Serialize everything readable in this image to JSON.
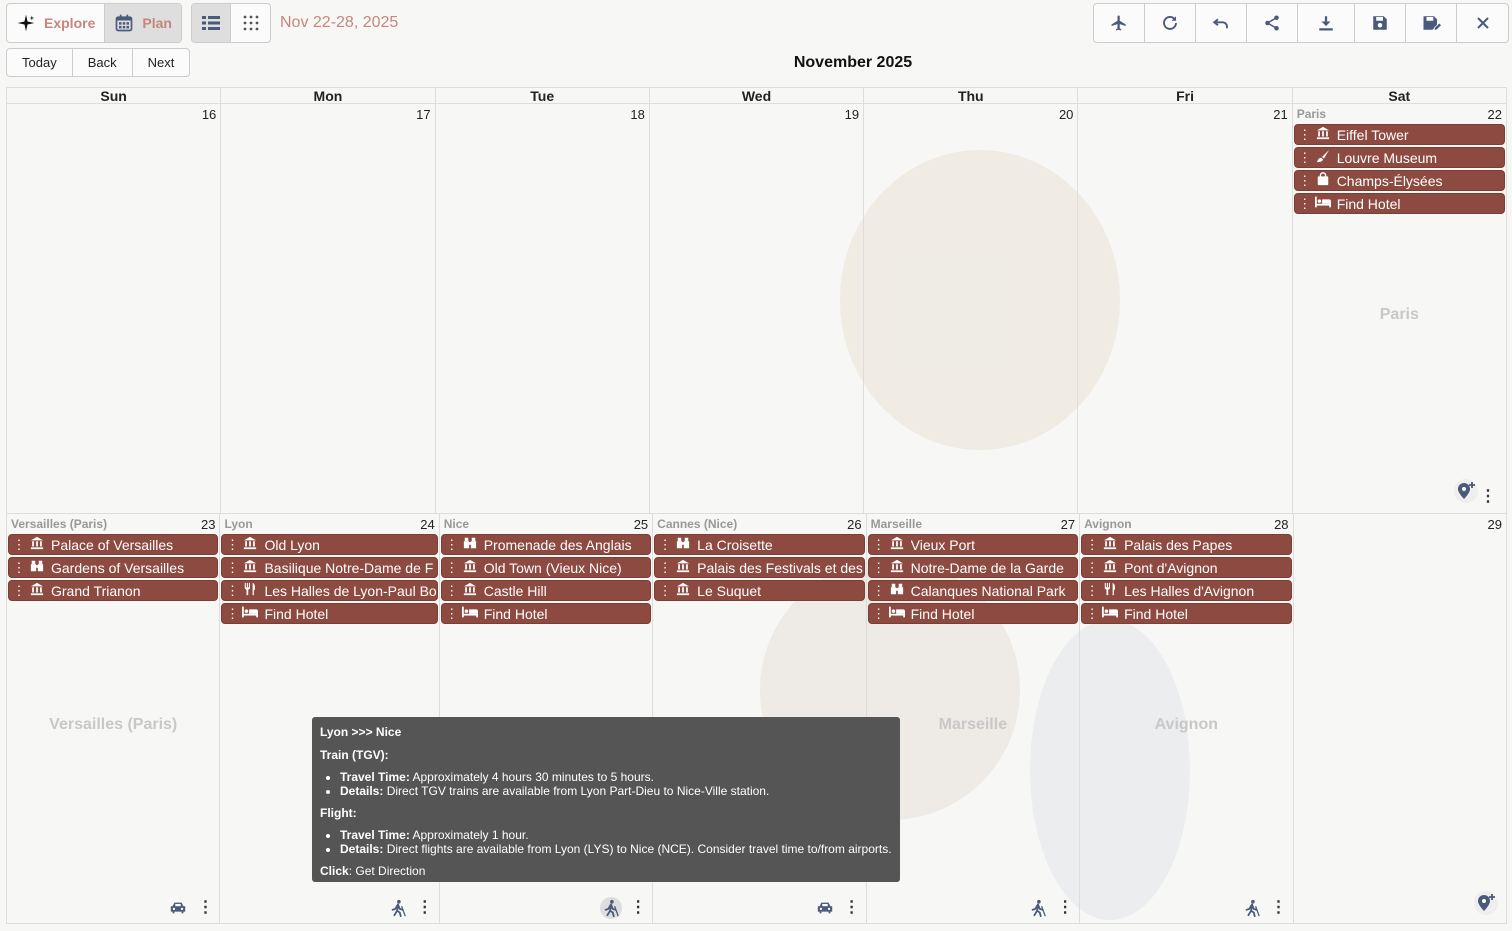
{
  "toolbar": {
    "explore_label": "Explore",
    "plan_label": "Plan",
    "date_range": "Nov 22-28, 2025",
    "today_label": "Today",
    "back_label": "Back",
    "next_label": "Next"
  },
  "calendar": {
    "month_title": "November 2025",
    "weekdays": [
      "Sun",
      "Mon",
      "Tue",
      "Wed",
      "Thu",
      "Fri",
      "Sat"
    ],
    "weeks": [
      {
        "days": [
          {
            "num": "16",
            "city": "",
            "watermark": "",
            "events": []
          },
          {
            "num": "17",
            "city": "",
            "watermark": "",
            "events": []
          },
          {
            "num": "18",
            "city": "",
            "watermark": "",
            "events": []
          },
          {
            "num": "19",
            "city": "",
            "watermark": "",
            "events": []
          },
          {
            "num": "20",
            "city": "",
            "watermark": "",
            "events": []
          },
          {
            "num": "21",
            "city": "",
            "watermark": "",
            "events": []
          },
          {
            "num": "22",
            "city": "Paris",
            "watermark": "Paris",
            "events": [
              {
                "icon": "museum-icon",
                "label": "Eiffel Tower"
              },
              {
                "icon": "brush-icon",
                "label": "Louvre Museum"
              },
              {
                "icon": "shopping-bag-icon",
                "label": "Champs-Élysées"
              },
              {
                "icon": "hotel-bed-icon",
                "label": "Find Hotel"
              }
            ]
          }
        ]
      },
      {
        "days": [
          {
            "num": "23",
            "city": "Versailles (Paris)",
            "watermark": "Versailles (Paris)",
            "events": [
              {
                "icon": "museum-icon",
                "label": "Palace of Versailles"
              },
              {
                "icon": "binoculars-icon",
                "label": "Gardens of Versailles"
              },
              {
                "icon": "museum-icon",
                "label": "Grand Trianon"
              }
            ]
          },
          {
            "num": "24",
            "city": "Lyon",
            "watermark": "",
            "events": [
              {
                "icon": "museum-icon",
                "label": "Old Lyon"
              },
              {
                "icon": "museum-icon",
                "label": "Basilique Notre-Dame de F"
              },
              {
                "icon": "fork-knife-icon",
                "label": "Les Halles de Lyon-Paul Bo"
              },
              {
                "icon": "hotel-bed-icon",
                "label": "Find Hotel"
              }
            ]
          },
          {
            "num": "25",
            "city": "Nice",
            "watermark": "",
            "events": [
              {
                "icon": "binoculars-icon",
                "label": "Promenade des Anglais"
              },
              {
                "icon": "museum-icon",
                "label": "Old Town (Vieux Nice)"
              },
              {
                "icon": "museum-icon",
                "label": "Castle Hill"
              },
              {
                "icon": "hotel-bed-icon",
                "label": "Find Hotel"
              }
            ]
          },
          {
            "num": "26",
            "city": "Cannes (Nice)",
            "watermark": "",
            "events": [
              {
                "icon": "binoculars-icon",
                "label": "La Croisette"
              },
              {
                "icon": "museum-icon",
                "label": "Palais des Festivals et des"
              },
              {
                "icon": "museum-icon",
                "label": "Le Suquet"
              }
            ]
          },
          {
            "num": "27",
            "city": "Marseille",
            "watermark": "Marseille",
            "events": [
              {
                "icon": "museum-icon",
                "label": "Vieux Port"
              },
              {
                "icon": "museum-icon",
                "label": "Notre-Dame de la Garde"
              },
              {
                "icon": "binoculars-icon",
                "label": "Calanques National Park"
              },
              {
                "icon": "hotel-bed-icon",
                "label": "Find Hotel"
              }
            ]
          },
          {
            "num": "28",
            "city": "Avignon",
            "watermark": "Avignon",
            "events": [
              {
                "icon": "museum-icon",
                "label": "Palais des Papes"
              },
              {
                "icon": "museum-icon",
                "label": "Pont d'Avignon"
              },
              {
                "icon": "fork-knife-icon",
                "label": "Les Halles d'Avignon"
              },
              {
                "icon": "hotel-bed-icon",
                "label": "Find Hotel"
              }
            ]
          },
          {
            "num": "29",
            "city": "",
            "watermark": "",
            "events": []
          }
        ]
      }
    ]
  },
  "tooltip": {
    "title": "Lyon >>> Nice",
    "train_heading": "Train (TGV):",
    "travel_time_key": "Travel Time:",
    "details_key": "Details:",
    "train_time": "Approximately 4 hours 30 minutes to 5 hours.",
    "train_details": "Direct TGV trains are available from Lyon Part-Dieu to Nice-Ville station.",
    "flight_heading": "Flight:",
    "flight_time": "Approximately 1 hour.",
    "flight_details": "Direct flights are available from Lyon (LYS) to Nice (NCE). Consider travel time to/from airports.",
    "click_key": "Click",
    "click_value": ": Get Direction"
  },
  "colors": {
    "event_bg": "#8d4a40",
    "accent": "#c6867c",
    "tooltip_bg": "#555555"
  }
}
